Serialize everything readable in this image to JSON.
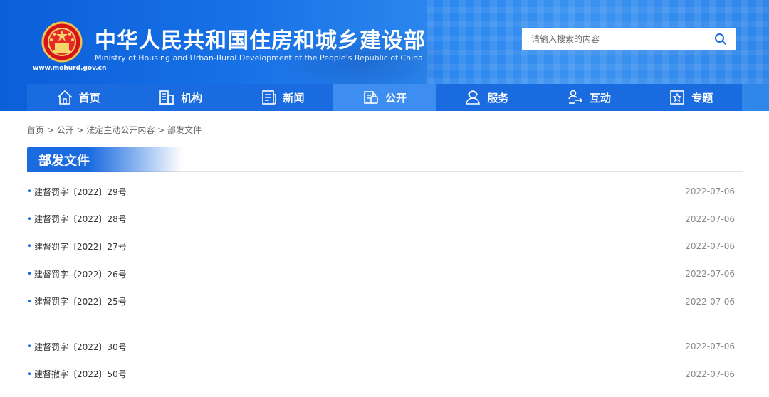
{
  "header": {
    "title": "中华人民共和国住房和城乡建设部",
    "subtitle": "Ministry of Housing and Urban-Rural Development of the People's Republic of China",
    "url": "www.mohurd.gov.cn"
  },
  "search": {
    "placeholder": "请输入搜索的内容",
    "icon": "search-icon"
  },
  "nav": {
    "items": [
      {
        "label": "首页",
        "icon": "home-icon"
      },
      {
        "label": "机构",
        "icon": "building-icon"
      },
      {
        "label": "新闻",
        "icon": "newspaper-icon"
      },
      {
        "label": "公开",
        "icon": "disclosure-icon",
        "active": true
      },
      {
        "label": "服务",
        "icon": "service-person-icon"
      },
      {
        "label": "互动",
        "icon": "interaction-icon"
      },
      {
        "label": "专题",
        "icon": "star-box-icon"
      }
    ]
  },
  "breadcrumb": {
    "text": "首页 > 公开 > 法定主动公开内容 > 部发文件"
  },
  "section": {
    "title": "部发文件"
  },
  "documents": {
    "group1": [
      {
        "title": "建督罚字〔2022〕29号",
        "date": "2022-07-06"
      },
      {
        "title": "建督罚字〔2022〕28号",
        "date": "2022-07-06"
      },
      {
        "title": "建督罚字〔2022〕27号",
        "date": "2022-07-06"
      },
      {
        "title": "建督罚字〔2022〕26号",
        "date": "2022-07-06"
      },
      {
        "title": "建督罚字〔2022〕25号",
        "date": "2022-07-06"
      }
    ],
    "group2": [
      {
        "title": "建督罚字〔2022〕30号",
        "date": "2022-07-06"
      },
      {
        "title": "建督撤字〔2022〕50号",
        "date": "2022-07-06"
      }
    ]
  },
  "colors": {
    "primary": "#1a6be0",
    "nav_active": "#3d8ef0",
    "header_blue": "#1770e6"
  }
}
